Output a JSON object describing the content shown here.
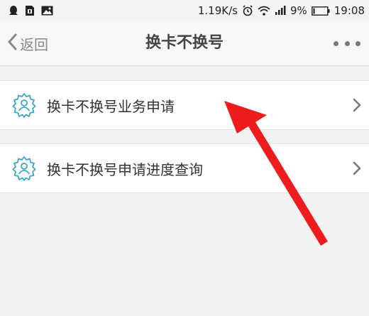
{
  "status_bar": {
    "net_speed": "1.19K/s",
    "battery": "9%",
    "time": "19:08"
  },
  "nav": {
    "back_label": "返回",
    "title": "换卡不换号"
  },
  "list": {
    "items": [
      {
        "label": "换卡不换号业务申请"
      },
      {
        "label": "换卡不换号申请进度查询"
      }
    ]
  },
  "colors": {
    "accent_icon": "#3aa7c7",
    "annotation_arrow": "#ee1c1c"
  },
  "icons": [
    "qq-icon",
    "sim-icon",
    "image-icon",
    "alarm-icon",
    "wifi-icon",
    "signal-icon",
    "battery-icon",
    "back-chevron-icon",
    "more-icon",
    "gear-person-icon",
    "chevron-right-icon"
  ]
}
